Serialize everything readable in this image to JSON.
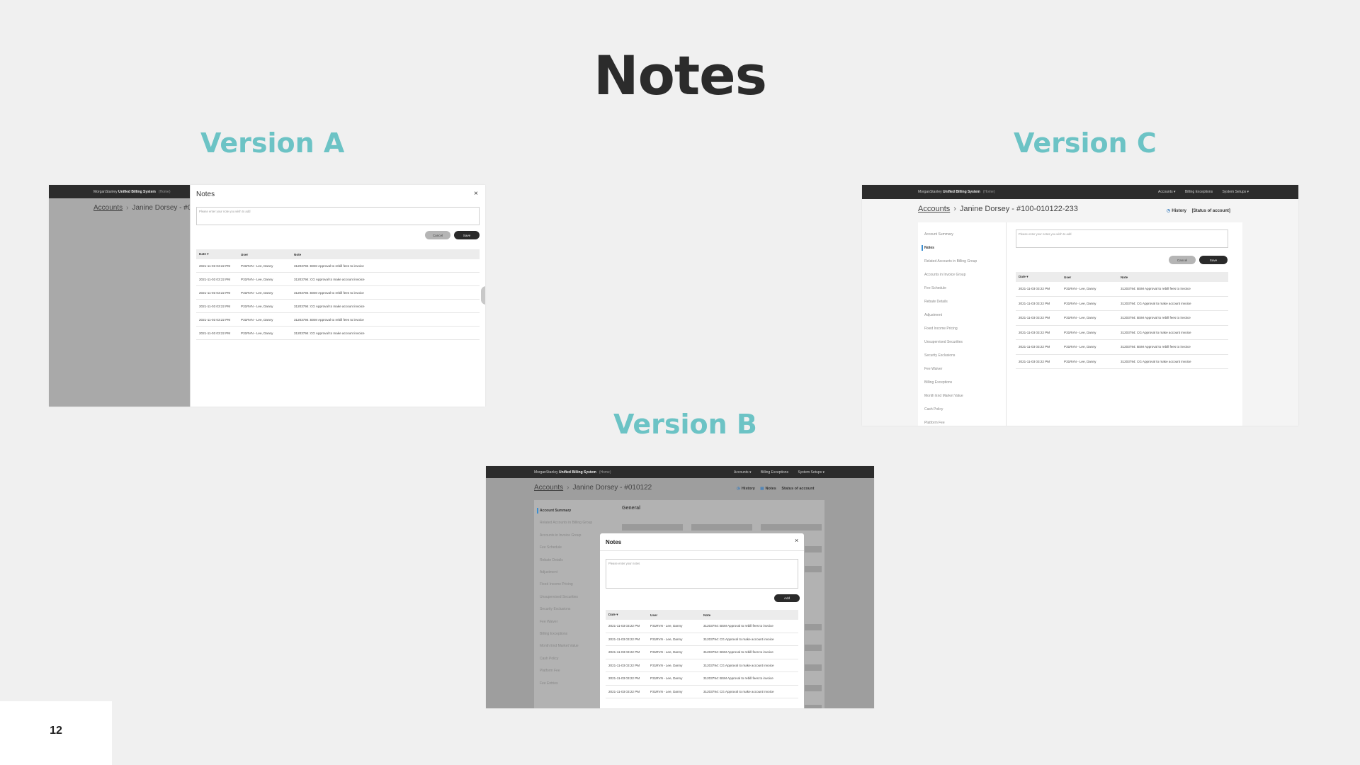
{
  "slide": {
    "title": "Notes",
    "page_number": "12",
    "labels": {
      "a": "Version A",
      "b": "Version B",
      "c": "Version C"
    }
  },
  "app": {
    "brand": "MorganStanley",
    "product": "Unified Billing System",
    "home": "(Home)",
    "nav": [
      "Accounts ▾",
      "Billing Exceptions",
      "System Setups ▾"
    ]
  },
  "version_a": {
    "crumb_accounts": "Accounts",
    "crumb_account_partial": "Janine Dorsey - #0",
    "modal_title": "Notes",
    "placeholder": "Please enter your note you wish to add",
    "cancel_label": "Cancel",
    "save_label": "Save",
    "columns": [
      "Date ▾",
      "User",
      "Note"
    ],
    "rows": [
      [
        "2021-11-03 03:22 PM",
        "P31RVN - Lee, Danny",
        "31203794: BSM Approval to rebill fees to invoice"
      ],
      [
        "2021-11-03 03:22 PM",
        "P31RVN - Lee, Danny",
        "31203794: CG Approval to make account invoice"
      ],
      [
        "2021-11-03 03:22 PM",
        "P31RVN - Lee, Danny",
        "31203794: BSM Approval to rebill fees to invoice"
      ],
      [
        "2021-11-03 03:22 PM",
        "P31RVN - Lee, Danny",
        "31203794: CG Approval to make account invoice"
      ],
      [
        "2021-11-03 03:22 PM",
        "P31RVN - Lee, Danny",
        "31203794: BSM Approval to rebill fees to invoice"
      ],
      [
        "2021-11-03 03:22 PM",
        "P31RVN - Lee, Danny",
        "31203794: CG Approval to make account invoice"
      ]
    ]
  },
  "version_b": {
    "crumb_accounts": "Accounts",
    "crumb_account": "Janine Dorsey - #010122",
    "actions": [
      "History",
      "Notes",
      "Status of account"
    ],
    "section_title": "General",
    "sidebar": [
      "Account Summary",
      "Related Accounts in Billing Group",
      "Accounts in Invoice Group",
      "Fee Schedule",
      "Rebate Details",
      "Adjustment",
      "Fixed Income Pricing",
      "Unsupervised Securities",
      "Security Exclusions",
      "Fee Waiver",
      "Billing Exceptions",
      "Month End Market Value",
      "Cash Policy",
      "Platform Fee",
      "Fee Entries"
    ],
    "modal_title": "Notes",
    "placeholder": "Please enter your notes",
    "add_label": "Add",
    "columns": [
      "Date ▾",
      "User",
      "Note"
    ],
    "rows": [
      [
        "2021-11-03 03:22 PM",
        "P31RVN - Lee, Danny",
        "31203794: BSM Approval to rebill fees to invoice"
      ],
      [
        "2021-11-03 03:22 PM",
        "P31RVN - Lee, Danny",
        "31203794: CG Approval to make account invoice"
      ],
      [
        "2021-11-03 03:22 PM",
        "P31RVN - Lee, Danny",
        "31203794: BSM Approval to rebill fees to invoice"
      ],
      [
        "2021-11-03 03:22 PM",
        "P31RVN - Lee, Danny",
        "31203794: CG Approval to make account invoice"
      ],
      [
        "2021-11-03 03:22 PM",
        "P31RVN - Lee, Danny",
        "31203794: BSM Approval to rebill fees to invoice"
      ],
      [
        "2021-11-03 03:22 PM",
        "P31RVN - Lee, Danny",
        "31203794: CG Approval to make account invoice"
      ]
    ]
  },
  "version_c": {
    "crumb_accounts": "Accounts",
    "crumb_account": "Janine Dorsey - #100-010122-233",
    "actions": [
      "History",
      "[Status of account]"
    ],
    "sidebar": [
      "Account Summary",
      "Notes",
      "Related Accounts in Billing Group",
      "Accounts in Invoice Group",
      "Fee Schedule",
      "Rebate Details",
      "Adjustment",
      "Fixed Income Pricing",
      "Unsupervised Securities",
      "Security Exclusions",
      "Fee Waiver",
      "Billing Exceptions",
      "Month End Market Value",
      "Cash Policy",
      "Platform Fee"
    ],
    "placeholder": "Please enter your notes you wish to add",
    "cancel_label": "Cancel",
    "save_label": "Save",
    "columns": [
      "Date ▾",
      "User",
      "Note"
    ],
    "rows": [
      [
        "2021-11-03 03:22 PM",
        "P31RVN - Lee, Danny",
        "31203794: BSM Approval to rebill fees to invoice"
      ],
      [
        "2021-11-03 03:22 PM",
        "P31RVN - Lee, Danny",
        "31203794: CG Approval to make account invoice"
      ],
      [
        "2021-11-03 03:22 PM",
        "P31RVN - Lee, Danny",
        "31203794: BSM Approval to rebill fees to invoice"
      ],
      [
        "2021-11-03 03:22 PM",
        "P31RVN - Lee, Danny",
        "31203794: CG Approval to make account invoice"
      ],
      [
        "2021-11-03 03:22 PM",
        "P31RVN - Lee, Danny",
        "31203794: BSM Approval to rebill fees to invoice"
      ],
      [
        "2021-11-03 03:22 PM",
        "P31RVN - Lee, Danny",
        "31203794: CG Approval to make account invoice"
      ]
    ]
  }
}
